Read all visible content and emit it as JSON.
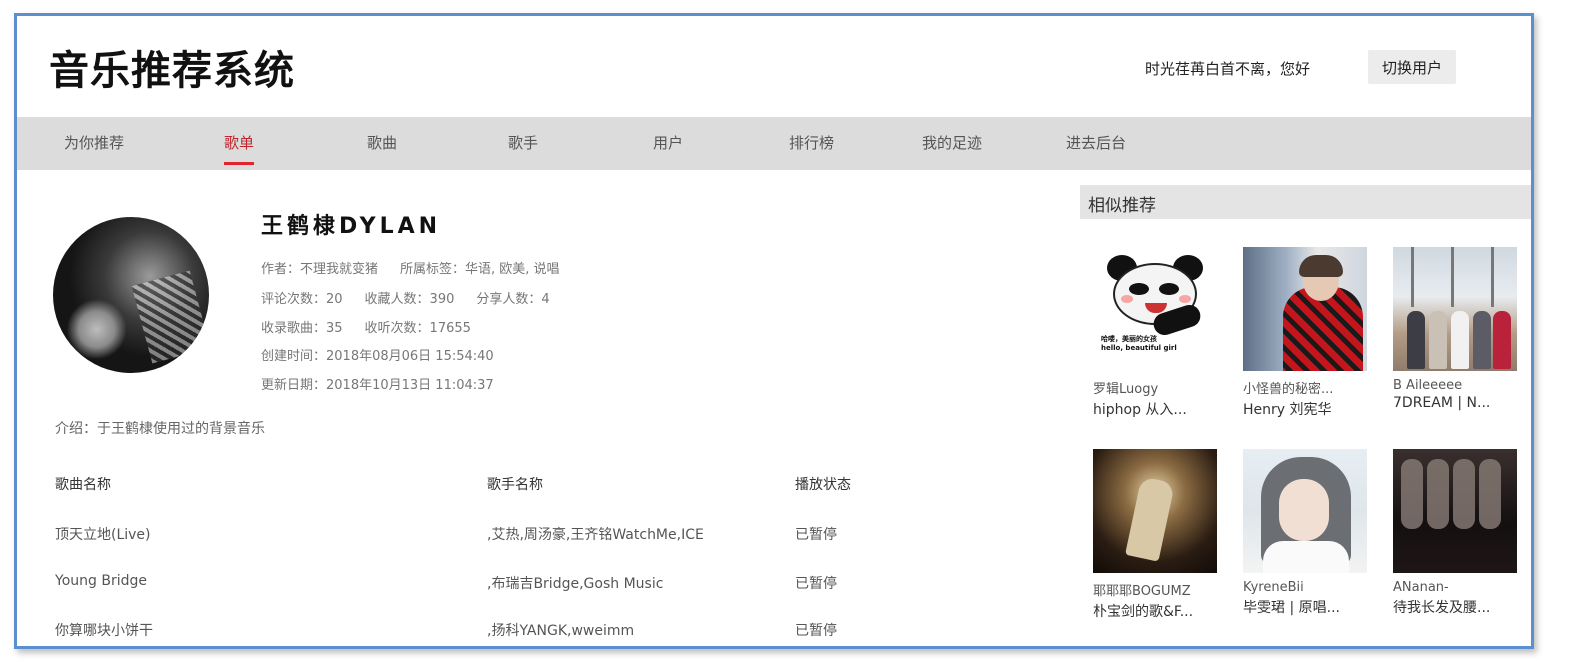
{
  "header": {
    "app_title": "音乐推荐系统",
    "greeting": "时光荏苒白首不离，您好",
    "switch_user_label": "切换用户"
  },
  "nav": {
    "items": [
      {
        "label": "为你推荐",
        "active": false
      },
      {
        "label": "歌单",
        "active": true
      },
      {
        "label": "歌曲",
        "active": false
      },
      {
        "label": "歌手",
        "active": false
      },
      {
        "label": "用户",
        "active": false
      },
      {
        "label": "排行榜",
        "active": false
      },
      {
        "label": "我的足迹",
        "active": false
      },
      {
        "label": "进去后台",
        "active": false
      }
    ],
    "active_color": "#e0262b"
  },
  "playlist": {
    "title": "王鹤棣DYLAN",
    "author": "作者：不理我就变猪",
    "tags": "所属标签：华语, 欧美, 说唱",
    "comments": "评论次数：20",
    "favorites": "收藏人数：390",
    "shares": "分享人数：4",
    "songs_count": "收录歌曲：35",
    "plays": "收听次数：17655",
    "created": "创建时间：2018年08月06日 15:54:40",
    "updated": "更新日期：2018年10月13日 11:04:37",
    "intro": "介绍：于王鹤棣使用过的背景音乐"
  },
  "songs": {
    "headers": [
      "歌曲名称",
      "歌手名称",
      "播放状态"
    ],
    "rows": [
      [
        "顶天立地(Live)",
        ",艾热,周汤豪,王齐铭WatchMe,ICE",
        "已暂停"
      ],
      [
        "Young Bridge",
        ",布瑞吉Bridge,Gosh Music",
        "已暂停"
      ],
      [
        "你算哪块小饼干",
        ",扬科YANGK,wweimm",
        "已暂停"
      ]
    ]
  },
  "similar": {
    "header": "相似推荐",
    "cards": [
      {
        "user": "罗辑Luogy",
        "name": "hiphop 从入...",
        "thumb": "panda-meme",
        "caption": "哈喽，美丽的女孩\nhello, beautiful girl"
      },
      {
        "user": "小怪兽的秘密...",
        "name": "Henry 刘宪华",
        "thumb": "red-plaid-person"
      },
      {
        "user": "B Aileeeee",
        "name": "7DREAM | N...",
        "thumb": "group-walking"
      },
      {
        "user": "耶耶耶BOGUMZ",
        "name": "朴宝剑的歌&F...",
        "thumb": "stage-performer"
      },
      {
        "user": "KyreneBii",
        "name": "毕雯珺 | 原唱...",
        "thumb": "white-robe-boy"
      },
      {
        "user": "ANanan-",
        "name": "待我长发及腰...",
        "thumb": "dark-poster"
      }
    ]
  }
}
